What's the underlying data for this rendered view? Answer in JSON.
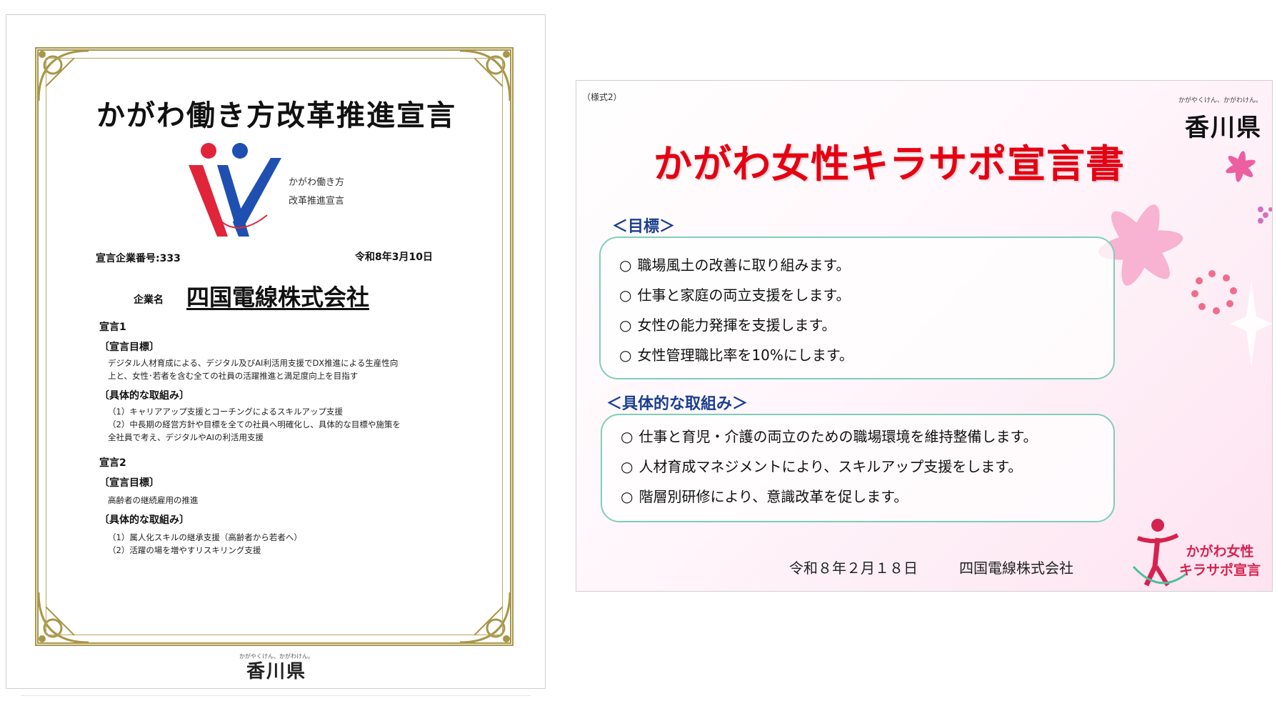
{
  "certificate": {
    "title": "かがわ働き方改革推進宣言",
    "logo_text_line1": "かがわ働き方",
    "logo_text_line2": "改革推進宣言",
    "number": "宣言企業番号:333",
    "date": "令和8年3月10日",
    "company_label": "企業名",
    "company": "四国電線株式会社",
    "declaration1": {
      "heading": "宣言1",
      "goal_heading": "〔宣言目標〕",
      "goal_line1": "デジタル人材育成による、デジタル及びAI利活用支援でDX推進による生産性向",
      "goal_line2": "上と、女性･若者を含む全ての社員の活躍推進と満足度向上を目指す",
      "actions_heading": "〔具体的な取組み〕",
      "action1": "（1）キャリアアップ支援とコーチングによるスキルアップ支援",
      "action2_line1": "（2）中長期の経営方針や目標を全ての社員へ明確化し、具体的な目標や施策を",
      "action2_line2": "全社員で考え、デジタルやAIの利活用支援"
    },
    "declaration2": {
      "heading": "宣言2",
      "goal_heading": "〔宣言目標〕",
      "goal_line1": "高齢者の継続雇用の推進",
      "actions_heading": "〔具体的な取組み〕",
      "action1": "（1）属人化スキルの継承支援（高齢者から若者へ）",
      "action2": "（2）活躍の場を増やすリスキリング支援"
    },
    "footer_small": "かがやくけん、かがわけん。",
    "footer": "香川県"
  },
  "declaration": {
    "form_label": "（様式2）",
    "pref_small": "かがやくけん、かがわけん。",
    "pref": "香川県",
    "title": "かがわ女性キラサポ宣言書",
    "goals_heading": "＜目標＞",
    "goals": [
      "職場風土の改善に取り組みます。",
      "仕事と家庭の両立支援をします。",
      "女性の能力発揮を支援します。",
      "女性管理職比率を10%にします。"
    ],
    "actions_heading": "＜具体的な取組み＞",
    "actions": [
      "仕事と育児・介護の両立のための職場環境を維持整備します。",
      "人材育成マネジメントにより、スキルアップ支援をします。",
      "階層別研修により、意識改革を促します。"
    ],
    "bullet": "○",
    "date": "令和８年２月１８日",
    "company": "四国電線株式会社",
    "logo_line1": "かがわ女性",
    "logo_line2": "キラサポ宣言"
  },
  "colors": {
    "frame_gold": "#a8964a",
    "title_red": "#e60012",
    "heading_blue": "#1a3f8f",
    "box_border": "#7fcfb8",
    "logo_red": "#d6224f",
    "logo_blue": "#1f4fb0"
  }
}
